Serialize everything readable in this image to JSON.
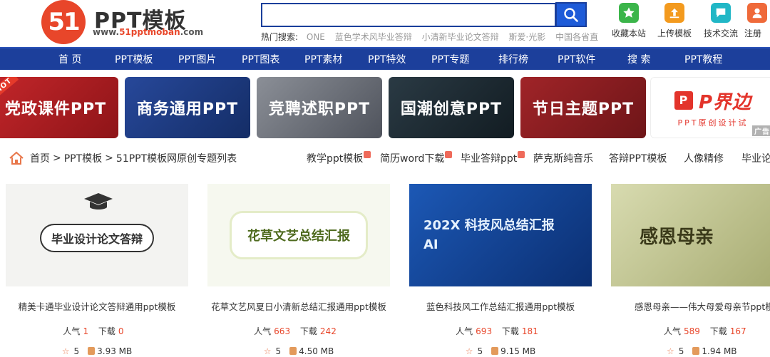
{
  "logo": {
    "mark": "51",
    "title": "PPT模板",
    "url_prefix": "www.",
    "url_brand": "51pptmoban",
    "url_suffix": ".com"
  },
  "search": {
    "placeholder": "",
    "hot_label": "热门搜索:",
    "hot_keywords": [
      "ONE",
      "蓝色学术风毕业答辩",
      "小清新毕业论文答辩",
      "斯爱·光影",
      "中国各省直"
    ]
  },
  "tools": [
    {
      "label": "收藏本站",
      "icon": "star-icon",
      "color": "#3bb54a"
    },
    {
      "label": "上传模板",
      "icon": "upload-icon",
      "color": "#f39a1e"
    },
    {
      "label": "技术交流",
      "icon": "chat-icon",
      "color": "#21b7c6"
    },
    {
      "label": "注册",
      "icon": "register-icon",
      "color": "#ef6a3a"
    }
  ],
  "nav": [
    "首 页",
    "PPT模板",
    "PPT图片",
    "PPT图表",
    "PPT素材",
    "PPT特效",
    "PPT专题",
    "排行榜",
    "PPT软件",
    "搜 索",
    "PPT教程"
  ],
  "banners": [
    {
      "text": "党政课件PPT",
      "color": "#b81e22",
      "tag": "HOT"
    },
    {
      "text": "商务通用PPT",
      "color": "#1e3a7a"
    },
    {
      "text": "竞聘述职PPT",
      "color": "#6b6f78"
    },
    {
      "text": "国潮创意PPT",
      "color": "#1f2c34"
    },
    {
      "text": "节日主题PPT",
      "color": "#8a1f22"
    },
    {
      "text": "P界边",
      "sub": "PPT原创设计试",
      "color": "#ffffff",
      "ad": "广告"
    }
  ],
  "breadcrumb": {
    "home": "首页",
    "sep": ">",
    "level1": "PPT模板",
    "level2": "51PPT模板网原创专题列表"
  },
  "tags": [
    {
      "label": "教学ppt模板",
      "new": true
    },
    {
      "label": "简历word下载",
      "new": true
    },
    {
      "label": "毕业答辩ppt",
      "new": true
    },
    {
      "label": "萨克斯纯音乐",
      "new": false
    },
    {
      "label": "答辩PPT模板",
      "new": false
    },
    {
      "label": "人像精修",
      "new": false
    },
    {
      "label": "毕业论文",
      "new": false
    }
  ],
  "cards": [
    {
      "title": "精美卡通毕业设计论文答辩通用ppt模板",
      "thumb_text": "毕业设计论文答辩",
      "bg": "#f3f3f1",
      "fg": "#333",
      "popularity_label": "人气",
      "popularity": "1",
      "downloads_label": "下载",
      "downloads": "0",
      "rating": "5",
      "size": "3.93 MB"
    },
    {
      "title": "花草文艺风夏日小清新总结汇报通用ppt模板",
      "thumb_text": "花草文艺总结汇报",
      "bg": "#f6f8ef",
      "fg": "#4e6a1e",
      "popularity_label": "人气",
      "popularity": "663",
      "downloads_label": "下载",
      "downloads": "242",
      "rating": "5",
      "size": "4.50 MB"
    },
    {
      "title": "蓝色科技风工作总结汇报通用ppt模板",
      "thumb_text": "202X 科技风总结汇报 AI",
      "bg": "#0f3f8e",
      "fg": "#e6f2ff",
      "popularity_label": "人气",
      "popularity": "693",
      "downloads_label": "下载",
      "downloads": "181",
      "rating": "5",
      "size": "9.15 MB"
    },
    {
      "title": "感恩母亲——伟大母爱母亲节ppt模板",
      "thumb_text": "感恩母亲",
      "bg": "#c9cd9a",
      "fg": "#3b3a1a",
      "popularity_label": "人气",
      "popularity": "589",
      "downloads_label": "下载",
      "downloads": "167",
      "rating": "5",
      "size": "1.94 MB"
    }
  ]
}
